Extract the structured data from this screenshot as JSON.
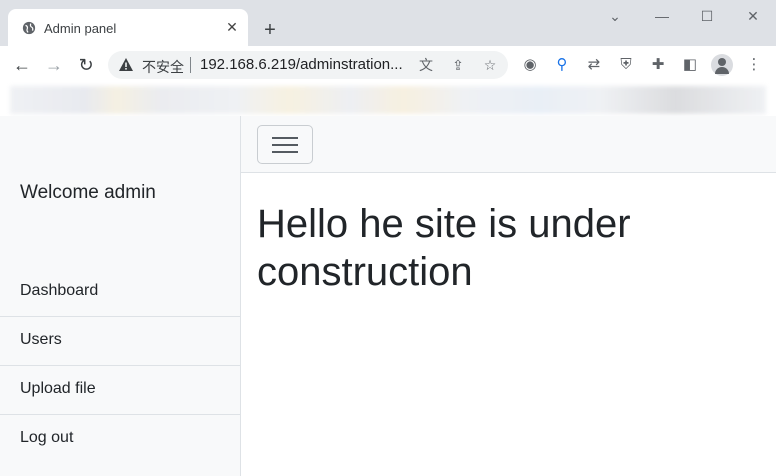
{
  "browser": {
    "tab": {
      "title": "Admin panel",
      "favicon": "globe-icon"
    },
    "address_bar": {
      "security_label": "不安全",
      "url": "192.168.6.219/adminstration..."
    }
  },
  "sidebar": {
    "welcome": "Welcome admin",
    "items": [
      {
        "label": "Dashboard"
      },
      {
        "label": "Users"
      },
      {
        "label": "Upload file"
      },
      {
        "label": "Log out"
      }
    ]
  },
  "main": {
    "heading": "Hello he site is under construction"
  }
}
